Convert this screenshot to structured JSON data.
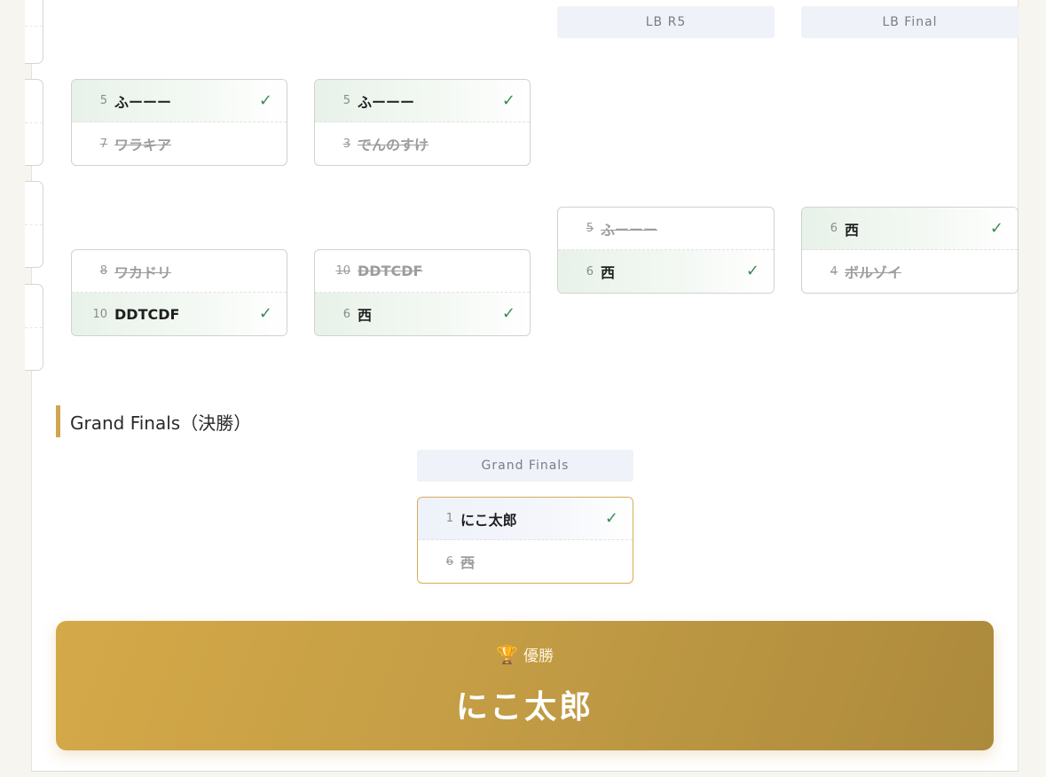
{
  "losers_bracket": {
    "round_headers": [
      "LB R5",
      "LB Final"
    ],
    "columns": [
      {
        "matches": [
          {
            "p1": {
              "seed": "5",
              "name": "ふーーー",
              "winner": true
            },
            "p2": {
              "seed": "7",
              "name": "ワラキア",
              "winner": false
            }
          },
          {
            "p1": {
              "seed": "8",
              "name": "ワカドリ",
              "winner": false
            },
            "p2": {
              "seed": "10",
              "name": "DDTCDF",
              "winner": true
            }
          }
        ]
      },
      {
        "matches": [
          {
            "p1": {
              "seed": "5",
              "name": "ふーーー",
              "winner": true
            },
            "p2": {
              "seed": "3",
              "name": "でんのすけ",
              "winner": false
            }
          },
          {
            "p1": {
              "seed": "10",
              "name": "DDTCDF",
              "winner": false
            },
            "p2": {
              "seed": "6",
              "name": "西",
              "winner": true
            }
          }
        ]
      },
      {
        "matches": [
          {
            "p1": {
              "seed": "5",
              "name": "ふーーー",
              "winner": false
            },
            "p2": {
              "seed": "6",
              "name": "西",
              "winner": true
            }
          }
        ]
      },
      {
        "matches": [
          {
            "p1": {
              "seed": "6",
              "name": "西",
              "winner": true
            },
            "p2": {
              "seed": "4",
              "name": "ボルゾイ",
              "winner": false
            }
          }
        ]
      }
    ]
  },
  "grand_finals": {
    "section_title": "Grand Finals（決勝）",
    "round_header": "Grand Finals",
    "match": {
      "p1": {
        "seed": "1",
        "name": "にこ太郎",
        "winner": true
      },
      "p2": {
        "seed": "6",
        "name": "西",
        "winner": false
      }
    }
  },
  "champion": {
    "icon": "trophy-icon",
    "label": "優勝",
    "name": "にこ太郎"
  },
  "check_mark": "✓",
  "colors": {
    "accent_gold": "#cfa650",
    "win_green": "#3f8a57",
    "header_bg": "#eff2f8"
  }
}
